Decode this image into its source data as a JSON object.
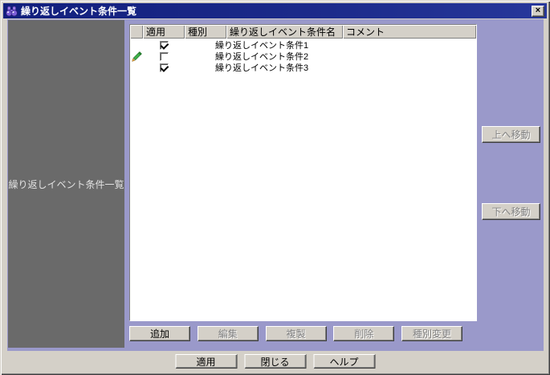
{
  "window": {
    "title": "繰り返しイベント条件一覧",
    "close_label": "×"
  },
  "sidebar": {
    "label": "繰り返しイベント条件一覧"
  },
  "table": {
    "columns": [
      {
        "label": ""
      },
      {
        "label": "適用"
      },
      {
        "label": "種別"
      },
      {
        "label": "繰り返しイベント条件名"
      },
      {
        "label": "コメント"
      }
    ],
    "rows": [
      {
        "name": "繰り返しイベント条件1",
        "applied": true,
        "editing": false,
        "type": "",
        "comment": ""
      },
      {
        "name": "繰り返しイベント条件2",
        "applied": false,
        "editing": true,
        "type": "",
        "comment": ""
      },
      {
        "name": "繰り返しイベント条件3",
        "applied": true,
        "editing": false,
        "type": "",
        "comment": ""
      }
    ]
  },
  "move_buttons": {
    "up": {
      "label": "上へ移動",
      "enabled": false
    },
    "down": {
      "label": "下へ移動",
      "enabled": false
    }
  },
  "list_buttons": {
    "add": {
      "label": "追加",
      "enabled": true
    },
    "edit": {
      "label": "編集",
      "enabled": false
    },
    "duplicate": {
      "label": "複製",
      "enabled": false
    },
    "delete": {
      "label": "削除",
      "enabled": false
    },
    "change_type": {
      "label": "種別変更",
      "enabled": false
    }
  },
  "dialog_buttons": {
    "apply": {
      "label": "適用",
      "enabled": true
    },
    "close": {
      "label": "閉じる",
      "enabled": true
    },
    "help": {
      "label": "ヘルプ",
      "enabled": true
    }
  },
  "colors": {
    "titlebar": "#18257f",
    "content_bg": "#9a99ca",
    "sidebar_bg": "#6a6a6a",
    "chrome": "#d4d0c8",
    "pencil_green": "#3fae49",
    "pencil_tip": "#e8a33d"
  }
}
